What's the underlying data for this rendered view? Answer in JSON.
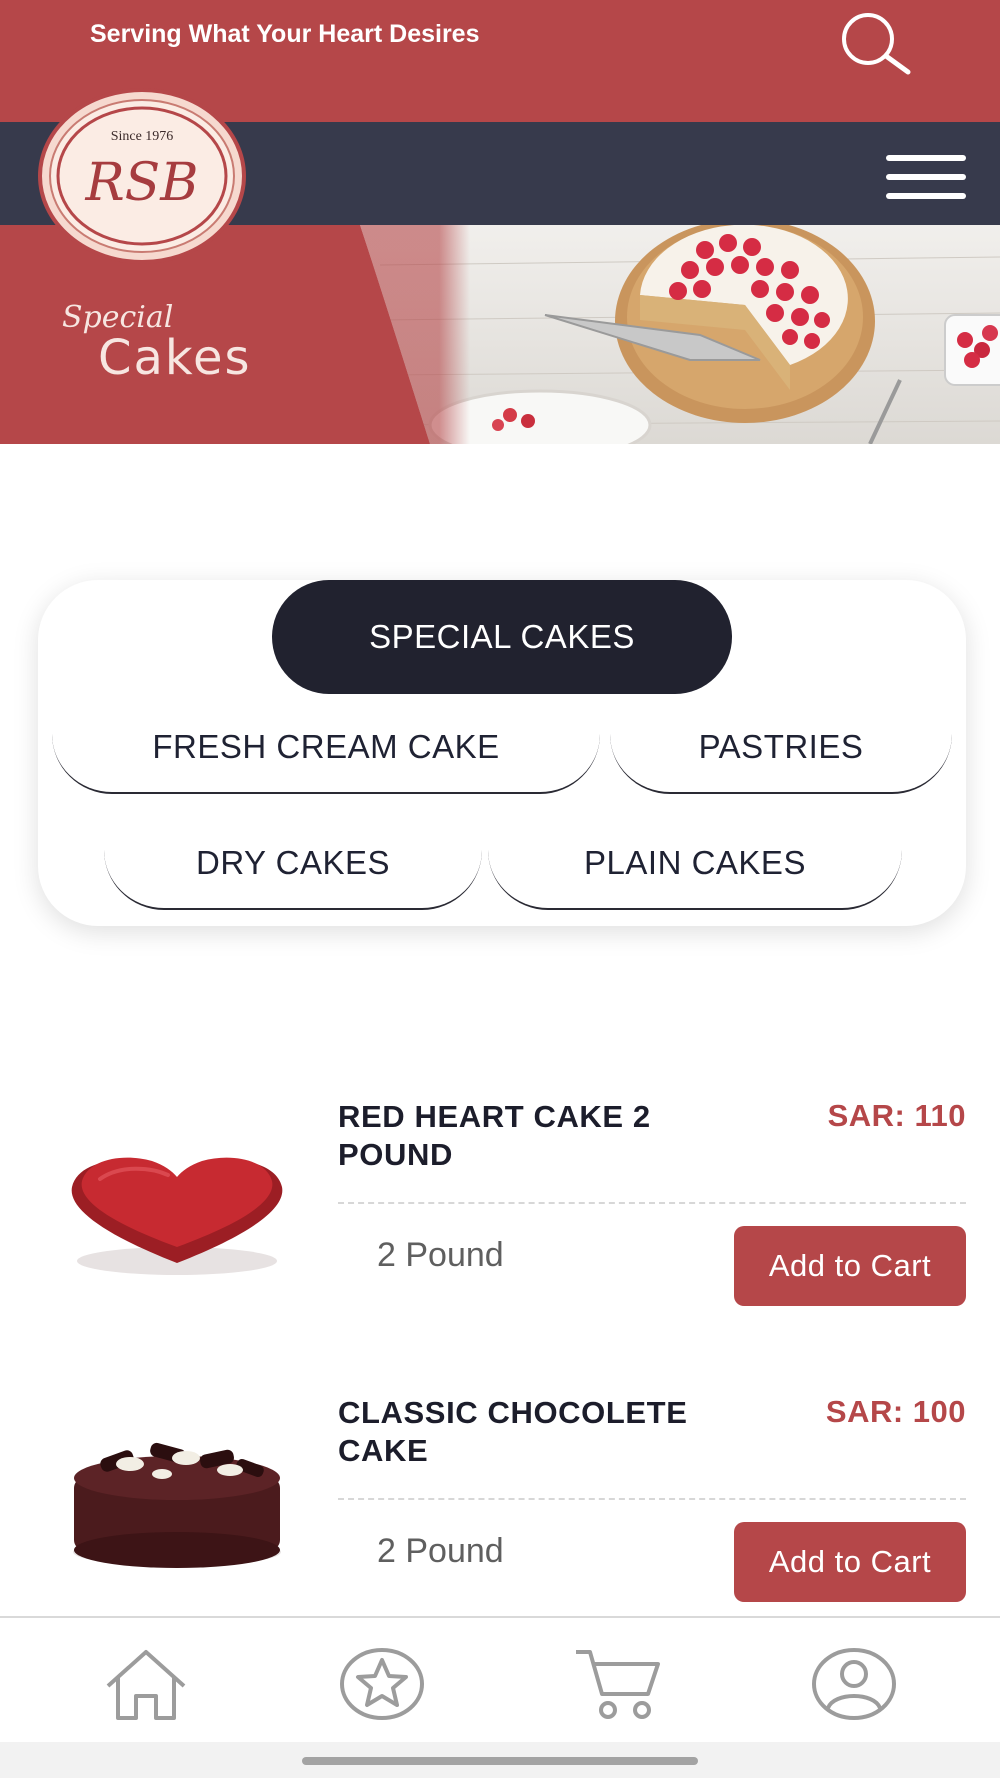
{
  "header": {
    "tagline": "Serving What Your Heart Desires",
    "search_icon": "search-icon",
    "menu_icon": "hamburger-menu-icon"
  },
  "logo": {
    "since": "Since 1976",
    "brand": "RSB"
  },
  "banner": {
    "script_text": "Special",
    "main_text": "Cakes"
  },
  "categories": [
    {
      "label": "SPECIAL CAKES",
      "active": true
    },
    {
      "label": "FRESH CREAM CAKE",
      "active": false
    },
    {
      "label": "PASTRIES",
      "active": false
    },
    {
      "label": "DRY CAKES",
      "active": false
    },
    {
      "label": "PLAIN CAKES",
      "active": false
    }
  ],
  "products": [
    {
      "name": "RED HEART CAKE 2 POUND",
      "price": "SAR: 110",
      "weight": "2 Pound",
      "button": "Add to Cart"
    },
    {
      "name": "CLASSIC CHOCOLETE CAKE",
      "price": "SAR: 100",
      "weight": "2 Pound",
      "button": "Add to Cart"
    }
  ],
  "bottom_nav": [
    "home-icon",
    "favorites-star-icon",
    "cart-icon",
    "profile-icon"
  ],
  "colors": {
    "brand_red": "#b54749",
    "nav_dark": "#373a4c",
    "chip_active": "#21222f"
  }
}
